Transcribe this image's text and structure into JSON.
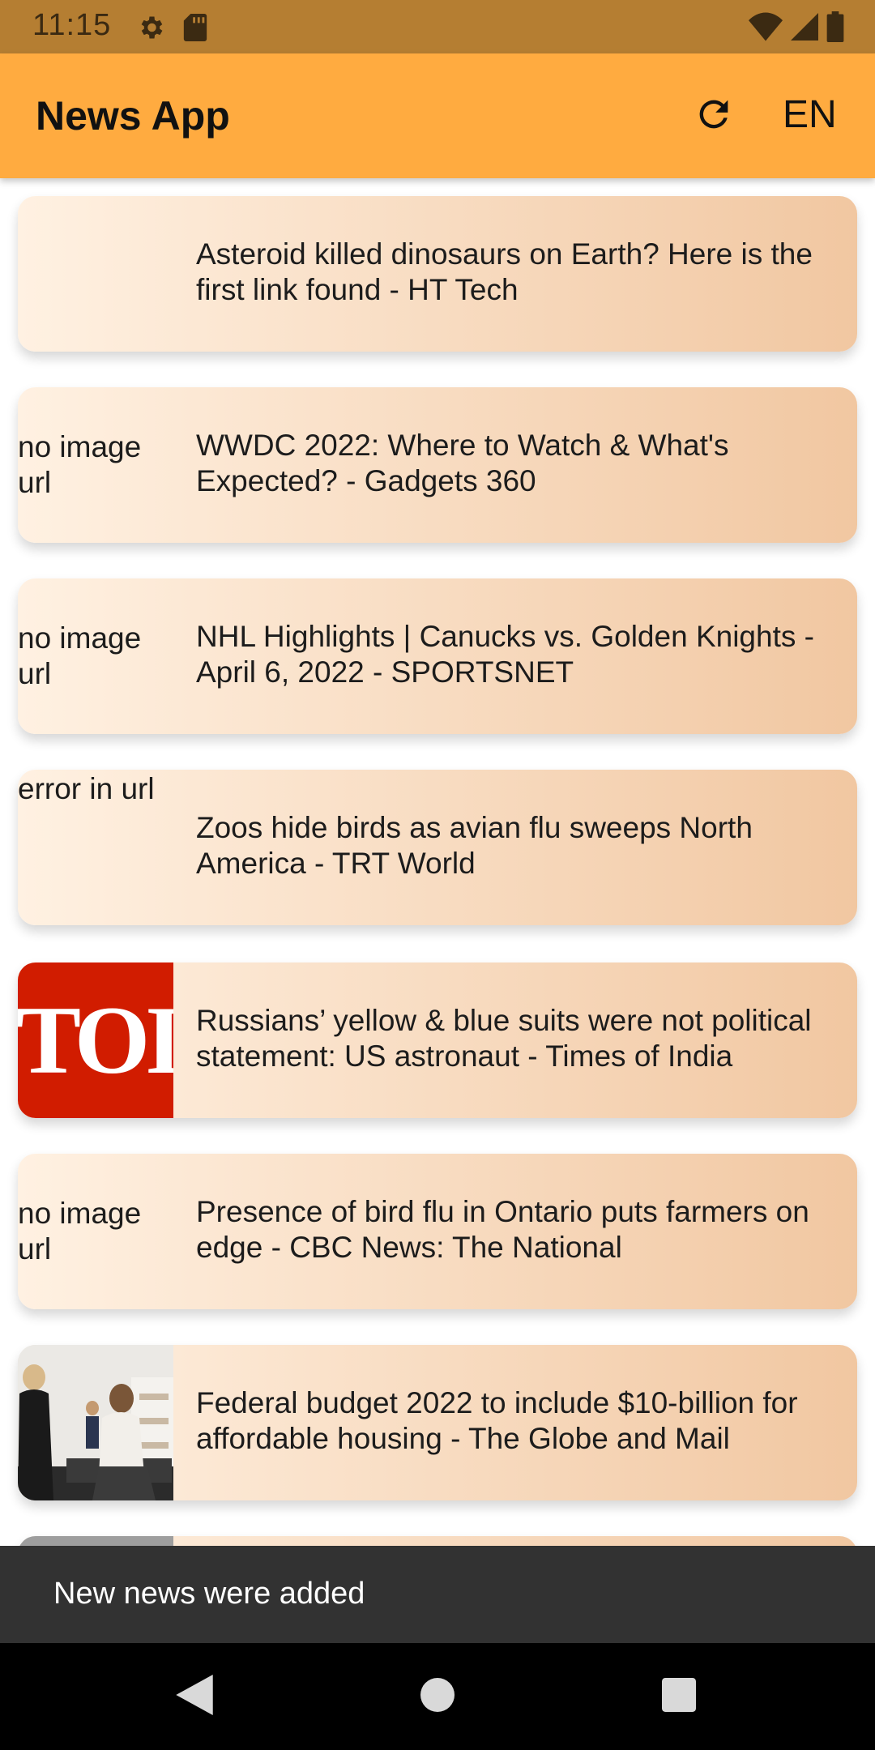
{
  "status_bar": {
    "time": "11:15",
    "left_icons": [
      "gear-icon",
      "sd-card-icon"
    ],
    "right_icons": [
      "wifi-icon",
      "signal-icon",
      "battery-icon"
    ]
  },
  "app_bar": {
    "title": "News App",
    "refresh_icon": "refresh-icon",
    "language": "EN",
    "color": "#ffab40"
  },
  "articles": [
    {
      "thumb_text": "",
      "title": "Asteroid killed dinosaurs on Earth? Here is the first link found - HT Tech"
    },
    {
      "thumb_text": "no image url",
      "title": "WWDC 2022: Where to Watch & What's Expected? - Gadgets 360"
    },
    {
      "thumb_text": "no image url",
      "title": "NHL Highlights | Canucks vs. Golden Knights - April 6, 2022 - SPORTSNET"
    },
    {
      "thumb_text": "error in url",
      "title": "Zoos hide birds as avian flu sweeps North America - TRT World"
    },
    {
      "thumb_text": "TOI",
      "title": "Russians’ yellow & blue suits were not political statement: US astronaut - Times of India"
    },
    {
      "thumb_text": "no image url",
      "title": "Presence of bird flu in Ontario puts farmers on edge - CBC News: The National"
    },
    {
      "thumb_text": "",
      "title": "Federal budget 2022 to include $10-billion for affordable housing - The Globe and Mail"
    }
  ],
  "snackbar": {
    "message": "New news were added"
  },
  "nav_bar": {
    "buttons": [
      "back-icon",
      "home-icon",
      "recents-icon"
    ]
  }
}
